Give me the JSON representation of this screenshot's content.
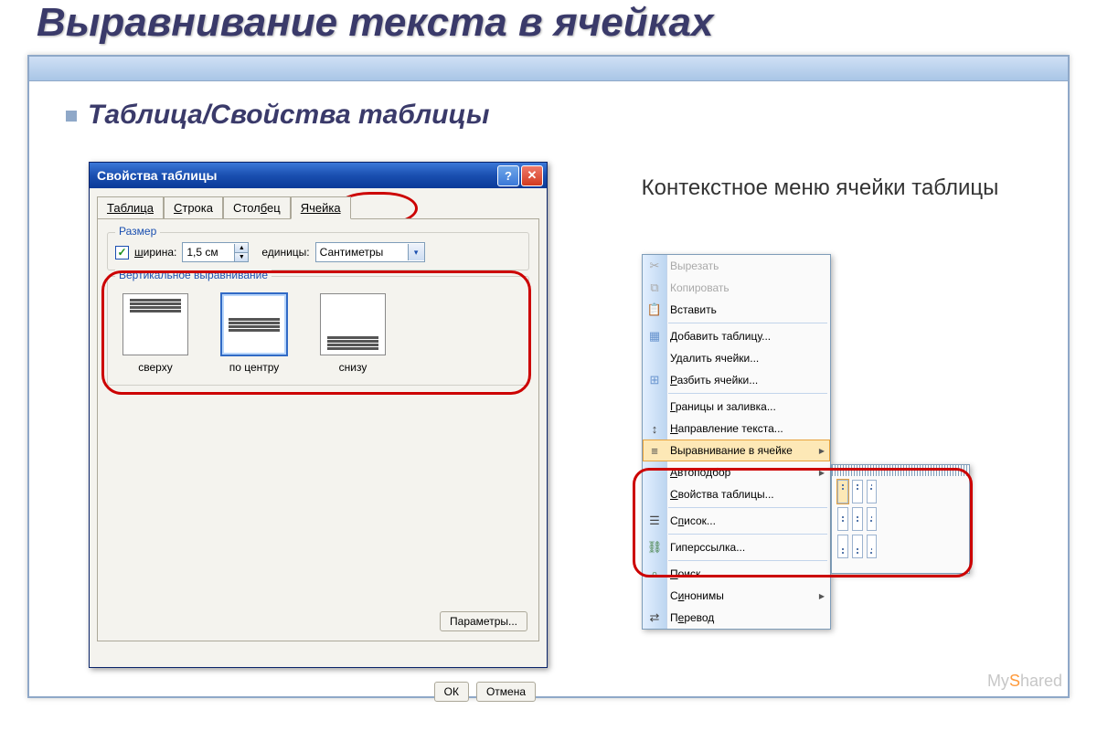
{
  "slide": {
    "title": "Выравнивание текста в ячейках",
    "subtitle": "Таблица/Свойства таблицы"
  },
  "dialog": {
    "title": "Свойства таблицы",
    "tabs": {
      "t1": "Таблица",
      "t2": "Строка",
      "t3": "Столбец",
      "t4": "Ячейка"
    },
    "group_size": "Размер",
    "width_label": "ширина:",
    "width_value": "1,5 см",
    "units_label": "единицы:",
    "units_value": "Сантиметры",
    "group_valign": "Вертикальное выравнивание",
    "align": {
      "top": "сверху",
      "center": "по центру",
      "bottom": "снизу"
    },
    "params_btn": "Параметры...",
    "ok": "ОК",
    "cancel": "Отмена"
  },
  "right_panel": {
    "title": "Контекстное меню ячейки таблицы"
  },
  "context_menu": {
    "cut": "Вырезать",
    "copy": "Копировать",
    "paste": "Вставить",
    "add_table": "Добавить таблицу...",
    "delete_cells": "Удалить ячейки...",
    "split_cells": "Разбить ячейки...",
    "borders": "Границы и заливка...",
    "text_dir": "Направление текста...",
    "cell_align": "Выравнивание в ячейке",
    "autofit": "Автоподбор",
    "props": "Свойства таблицы...",
    "list": "Список...",
    "hyperlink": "Гиперссылка...",
    "search": "Поиск...",
    "synonyms": "Синонимы",
    "translate": "Перевод"
  },
  "watermark": {
    "a": "My",
    "b": "S",
    "c": "hared"
  }
}
